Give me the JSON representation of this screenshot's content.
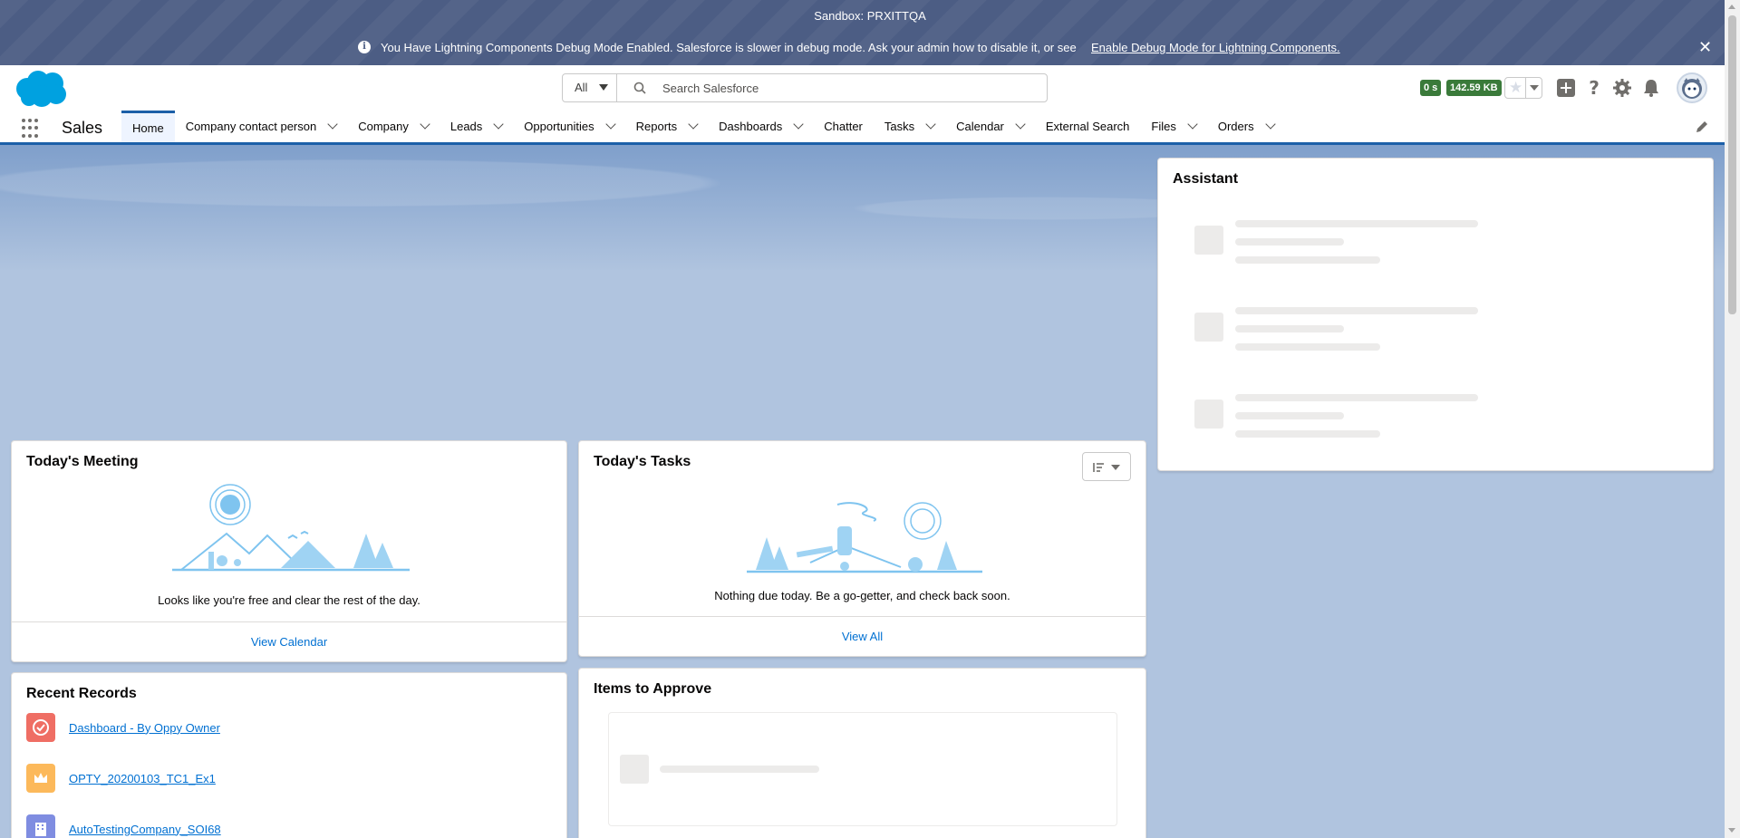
{
  "sandbox": {
    "title": "Sandbox: PRXITTQA",
    "debug_message": "You Have Lightning Components Debug Mode Enabled. Salesforce is slower in debug mode. Ask your admin how to disable it, or see",
    "debug_link": "Enable Debug Mode for Lightning Components."
  },
  "header": {
    "search_scope": "All",
    "search_placeholder": "Search Salesforce",
    "perf_time": "0 s",
    "perf_size": "142.59 KB",
    "icons": [
      "add-icon",
      "help-icon",
      "setup-gear-icon",
      "notification-bell-icon",
      "avatar"
    ]
  },
  "nav": {
    "app_name": "Sales",
    "items": [
      {
        "label": "Home",
        "active": true,
        "dropdown": false
      },
      {
        "label": "Company contact person",
        "dropdown": true
      },
      {
        "label": "Company",
        "dropdown": true
      },
      {
        "label": "Leads",
        "dropdown": true
      },
      {
        "label": "Opportunities",
        "dropdown": true
      },
      {
        "label": "Reports",
        "dropdown": true
      },
      {
        "label": "Dashboards",
        "dropdown": true
      },
      {
        "label": "Chatter",
        "dropdown": false
      },
      {
        "label": "Tasks",
        "dropdown": true
      },
      {
        "label": "Calendar",
        "dropdown": true
      },
      {
        "label": "External Search",
        "dropdown": false
      },
      {
        "label": "Files",
        "dropdown": true
      },
      {
        "label": "Orders",
        "dropdown": true
      }
    ]
  },
  "assistant": {
    "title": "Assistant"
  },
  "meeting": {
    "title": "Today's Meeting",
    "empty_text": "Looks like you're free and clear the rest of the day.",
    "footer": "View Calendar"
  },
  "tasks": {
    "title": "Today's Tasks",
    "empty_text": "Nothing due today. Be a go-getter, and check back soon.",
    "footer": "View All"
  },
  "recent": {
    "title": "Recent Records",
    "items": [
      {
        "label": "Dashboard - By Oppy Owner",
        "icon": "dashboard-icon",
        "color": "#ef6e64"
      },
      {
        "label": "OPTY_20200103_TC1_Ex1",
        "icon": "opportunity-crown-icon",
        "color": "#fcb95b"
      },
      {
        "label": "AutoTestingCompany_SOI68",
        "icon": "account-building-icon",
        "color": "#7f8de1"
      }
    ]
  },
  "approve": {
    "title": "Items to Approve"
  },
  "colors": {
    "brand": "#1b5fa8",
    "link": "#0070d2",
    "sandbox_bar": "#4c5d84",
    "perf_badge": "#3a7a3a",
    "page_bg": "#b0c4df"
  }
}
